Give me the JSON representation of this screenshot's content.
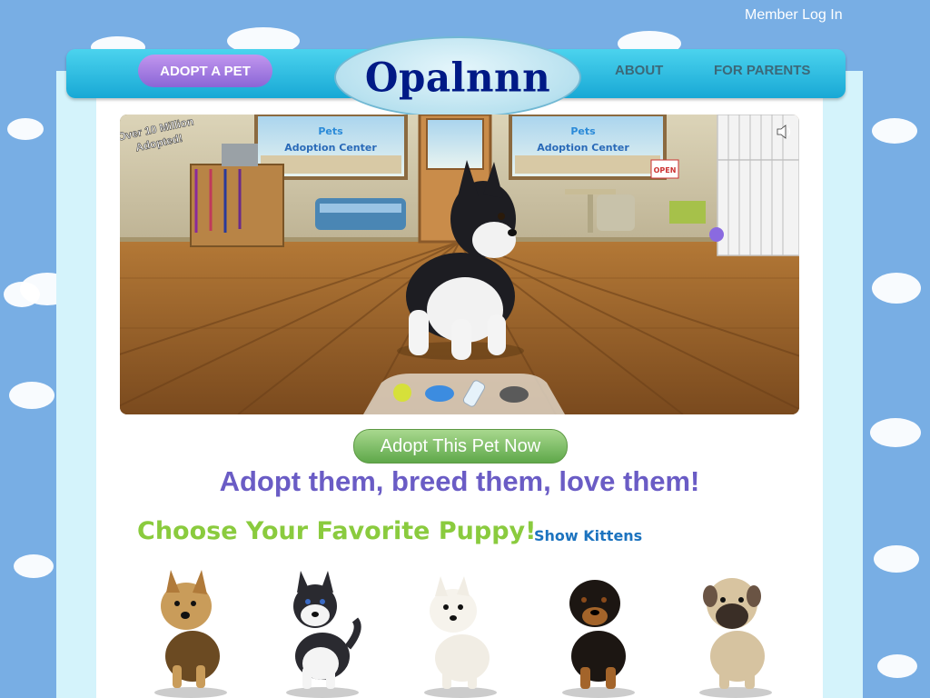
{
  "header": {
    "member_login": "Member Log In",
    "adopt_button": "ADOPT A PET",
    "logo": "Opalnnn",
    "nav": [
      "ABOUT",
      "FOR PARENTS"
    ]
  },
  "hero": {
    "badge_line1": "Over 10 Million",
    "badge_line2": "Adopted!",
    "window_sign": "Adoption Center",
    "window_brand": "Pets",
    "open_sign": "OPEN",
    "tray_items": [
      "tennis-ball",
      "frisbee",
      "water-bottle",
      "food-bowl"
    ],
    "sound_icon": "speaker-icon"
  },
  "cta": {
    "label": "Adopt This Pet Now"
  },
  "tagline": "Adopt them, breed them, love them!",
  "choose": {
    "heading": "Choose Your Favorite Puppy!",
    "link": "Show Kittens"
  },
  "puppies": [
    {
      "breed": "yorkshire-terrier"
    },
    {
      "breed": "husky"
    },
    {
      "breed": "westie"
    },
    {
      "breed": "rottweiler"
    },
    {
      "breed": "mastiff"
    }
  ],
  "colors": {
    "sky": "#78aee4",
    "nav": "#18a8d5",
    "adopt_button": "#8a66d6",
    "cta": "#5fa84a",
    "tagline": "#6a5cc5",
    "choose_heading": "#8acb3e",
    "link": "#1c73bf"
  }
}
